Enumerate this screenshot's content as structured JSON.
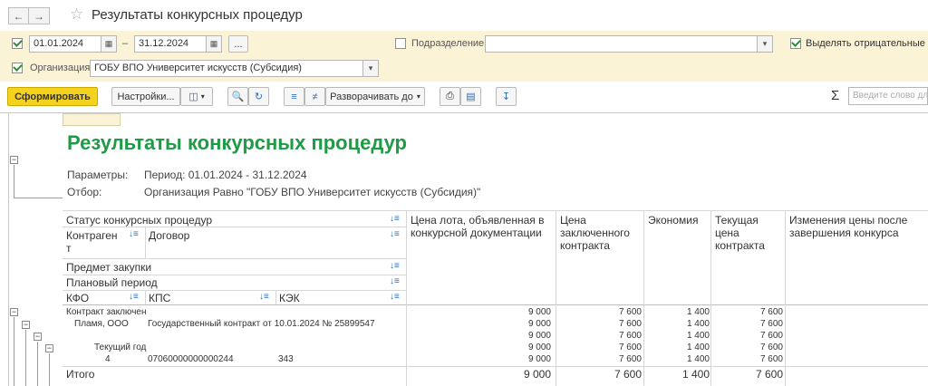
{
  "window": {
    "title": "Результаты конкурсных процедур"
  },
  "params": {
    "date_from": "01.01.2024",
    "date_dash": "–",
    "date_to": "31.12.2024",
    "more_button": "...",
    "subdivision_label": "Подразделение:",
    "subdivision_value": "",
    "highlight_negative_label": "Выделять отрицательные",
    "organization_label": "Организация:",
    "organization_value": "ГОБУ ВПО Университет искусств (Субсидия)"
  },
  "toolbar": {
    "generate": "Сформировать",
    "settings": "Настройки...",
    "expand_to": "Разворачивать до",
    "search_placeholder": "Введите слово для поиска",
    "sigma": "Σ"
  },
  "report": {
    "title": "Результаты конкурсных процедур",
    "params_label": "Параметры:",
    "params_value": "Период: 01.01.2024 - 31.12.2024",
    "filter_label": "Отбор:",
    "filter_value": "Организация Равно \"ГОБУ ВПО Университет искусств (Субсидия)\"",
    "headers": {
      "status": "Статус конкурсных процедур",
      "contractor": "Контраген т",
      "contract": "Договор",
      "subject": "Предмет закупки",
      "planned_period": "Плановый период",
      "kfo": "КФО",
      "kps": "КПС",
      "kek": "КЭК",
      "lot_price": "Цена лота, объявленная в конкурсной документации",
      "contract_price": "Цена заключенного контракта",
      "economy": "Экономия",
      "current_price": "Текущая цена контракта",
      "price_changes": "Изменения цены после завершения конкурса"
    },
    "rows": [
      {
        "c1": "Контракт заключен",
        "c2": "",
        "c3": "",
        "lot": "9 000",
        "contract": "7 600",
        "economy": "1 400",
        "current": "7 600",
        "changes": ""
      },
      {
        "c1": "Пламя, ООО",
        "c2": "Государственный контракт от 10.01.2024 № 25899547",
        "c3": "",
        "lot": "9 000",
        "contract": "7 600",
        "economy": "1 400",
        "current": "7 600",
        "changes": ""
      },
      {
        "c1": "",
        "c2": "",
        "c3": "",
        "lot": "9 000",
        "contract": "7 600",
        "economy": "1 400",
        "current": "7 600",
        "changes": ""
      },
      {
        "c1": "Текущий год",
        "c2": "",
        "c3": "",
        "lot": "9 000",
        "contract": "7 600",
        "economy": "1 400",
        "current": "7 600",
        "changes": ""
      },
      {
        "c1": "4",
        "c2": "07060000000000244",
        "c3": "343",
        "lot": "9 000",
        "contract": "7 600",
        "economy": "1 400",
        "current": "7 600",
        "changes": ""
      }
    ],
    "total": {
      "label": "Итого",
      "lot": "9 000",
      "contract": "7 600",
      "economy": "1 400",
      "current": "7 600"
    }
  }
}
